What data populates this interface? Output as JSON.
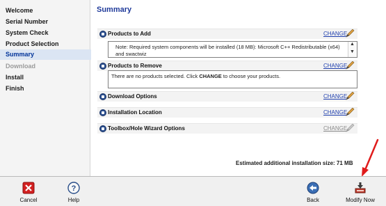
{
  "sidebar": {
    "items": [
      {
        "label": "Welcome",
        "state": "done"
      },
      {
        "label": "Serial Number",
        "state": "done"
      },
      {
        "label": "System Check",
        "state": "done"
      },
      {
        "label": "Product Selection",
        "state": "done"
      },
      {
        "label": "Summary",
        "state": "active"
      },
      {
        "label": "Download",
        "state": "disabled"
      },
      {
        "label": "Install",
        "state": "pending"
      },
      {
        "label": "Finish",
        "state": "pending"
      }
    ]
  },
  "main": {
    "title": "Summary",
    "sections": [
      {
        "label": "Products to Add",
        "change": "CHANGE",
        "enabled": true,
        "detail": "Note:  Required system components will be installed (18 MB): Microsoft C++ Redistributable (x64) and swactwiz"
      },
      {
        "label": "Products to Remove",
        "change": "CHANGE",
        "enabled": true,
        "detail_prefix": "There are no products selected. Click ",
        "detail_bold": "CHANGE",
        "detail_suffix": " to choose your products."
      },
      {
        "label": "Download Options",
        "change": "CHANGE",
        "enabled": true
      },
      {
        "label": "Installation Location",
        "change": "CHANGE",
        "enabled": true
      },
      {
        "label": "Toolbox/Hole Wizard Options",
        "change": "CHANGE",
        "enabled": false
      }
    ],
    "estimated_size": "Estimated additional installation size: 71 MB"
  },
  "bottom": {
    "cancel": "Cancel",
    "help": "Help",
    "back": "Back",
    "modify": "Modify Now"
  },
  "colors": {
    "accent": "#1f3a9a",
    "link": "#1f3fae",
    "cancel": "#d32020",
    "arrow": "#e01b1b"
  }
}
